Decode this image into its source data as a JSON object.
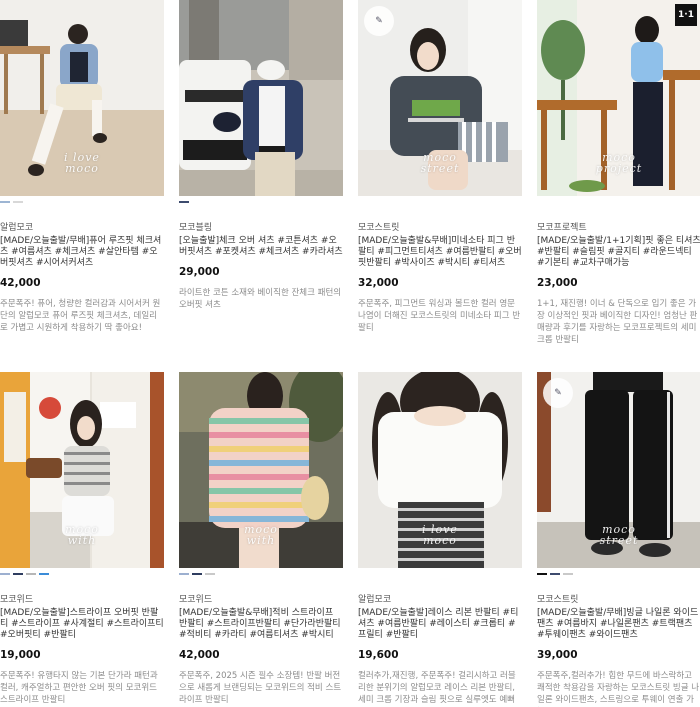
{
  "products": [
    {
      "brand": "알럽모코",
      "title": "[MADE/오늘출발/무배]퓨어 루즈핏 체크셔츠 #여름셔츠 #체크셔츠 #살안타템 #오버핏셔츠 #시어서커셔츠",
      "price": "42,000",
      "desc": "주문폭주! 퓨어, 청량한 컬러감과 시어서커 원단의 알럽모코 퓨어 루즈핏 체크셔츠, 데일리로 가볍고 시원하게 착용하기 딱 좋아요!",
      "watermark_line1": "i love",
      "watermark_line2": "moco",
      "swatches": [
        "#9db5d3",
        "#d8d8d8"
      ],
      "icons": []
    },
    {
      "brand": "모코블링",
      "title": "[오늘출발]체크 오버 셔츠 #코튼셔츠 #오버핏셔츠 #포켓셔츠 #체크셔츠 #카라셔츠",
      "price": "29,000",
      "desc": "라이트한 코튼 소재와 베이직한 잔체크 패턴의 오버핏 셔츠",
      "watermark_line1": "",
      "watermark_line2": "",
      "swatches": [
        "#3d4b6e"
      ],
      "icons": []
    },
    {
      "brand": "모코스트릿",
      "title": "[MADE/오늘출발&무배]미네소타 피그 반팔티 #피그먼트티셔츠 #여름반팔티 #오버핏반팔티 #박사이즈 #박시티 #티셔츠",
      "price": "32,000",
      "desc": "주문폭주, 피그먼트 워싱과 볼드한 컬러 영문 나염이 더해진 모코스트릿의 미네소타 피그 반팔티",
      "watermark_line1": "moco",
      "watermark_line2": "street",
      "swatches": [],
      "icons": [
        "badge-icon"
      ]
    },
    {
      "brand": "모코프로젝트",
      "title": "[MADE/오늘출발/1+1기획]핏 좋은 티셔츠 #반팔티 #슬림핏 #골지티 #라운드넥티 #기본티 #교차구매가능",
      "price": "23,000",
      "desc": "1+1, 재진행! 이너 & 단독으로 입기 좋은 가장 이상적인 핏과 베이직한 디자인! 엄청난 판매량과 후기를 자랑하는 모코프로젝트의 세미크롭 반팔티",
      "watermark_line1": "moco",
      "watermark_line2": "project",
      "swatches": [],
      "icons": [
        "square-logo-icon"
      ],
      "square_logo_text": "1·1"
    },
    {
      "brand": "모코위드",
      "title": "[MADE/오늘출발]스트라이프 오버핏 반팔티 #스트라이프 #사계절티 #스트라이프티 #오버핏티 #반팔티",
      "price": "19,000",
      "desc": "주문폭주! 유행타지 않는 기본 단가라 패턴과 컬러, 캐주얼하고 편안한 오버 핏의 모코위드 스트라이프 반팔티",
      "watermark_line1": "moco",
      "watermark_line2": "with",
      "swatches": [
        "#9db0d0",
        "#2f3d60",
        "#b7b7b7",
        "#3b8cd8"
      ],
      "icons": []
    },
    {
      "brand": "모코위드",
      "title": "[MADE/오늘출발&무배]적비 스트라이프 반팔티 #스트라이프반팔티 #단가라반팔티 #적비티 #카라티 #여름티셔츠 #박시티",
      "price": "42,000",
      "desc": "주문폭주, 2025 시즌 필수 소장템! 반팔 버전으로 새롭게 브랜딩되는 모코위드의 적비 스트라이프 반팔티",
      "watermark_line1": "moco",
      "watermark_line2": "with",
      "swatches": [
        "#9db0d0",
        "#2f3d60",
        "#c9c9c9"
      ],
      "icons": []
    },
    {
      "brand": "알럽모코",
      "title": "[MADE/오늘출발]레이스 리본 반팔티 #티셔츠 #여름반팔티 #레이스티 #크롭티 #프릴티 #반팔티",
      "price": "19,600",
      "desc": "컬러추가,재진행, 주문폭주! 걸리시하고 러블리한 분위기의 알럽모코 레이스 리본 반팔티, 세미 크롭 기장과 슬림 핏으로 실루엣도 예뻐요 :)",
      "watermark_line1": "i love",
      "watermark_line2": "moco",
      "swatches": [],
      "icons": []
    },
    {
      "brand": "모코스트릿",
      "title": "[MADE/오늘출발/무배]빙글 나일론 와이드팬츠 #여름바지 #나일론팬츠 #트랙팬츠 #투웨이팬츠 #와이드팬츠",
      "price": "39,000",
      "desc": "주문폭주,컬러추가! 힙한 무드에 바스락하고 쾌적한 착용감을 자랑하는 모코스트릿 빙글 나일론 와이드팬츠, 스트링으로 투웨이 연출 가능",
      "watermark_line1": "moco",
      "watermark_line2": "street",
      "swatches": [
        "#111111",
        "#3d4b6e",
        "#c9c9c9"
      ],
      "icons": [
        "badge-icon"
      ]
    }
  ]
}
